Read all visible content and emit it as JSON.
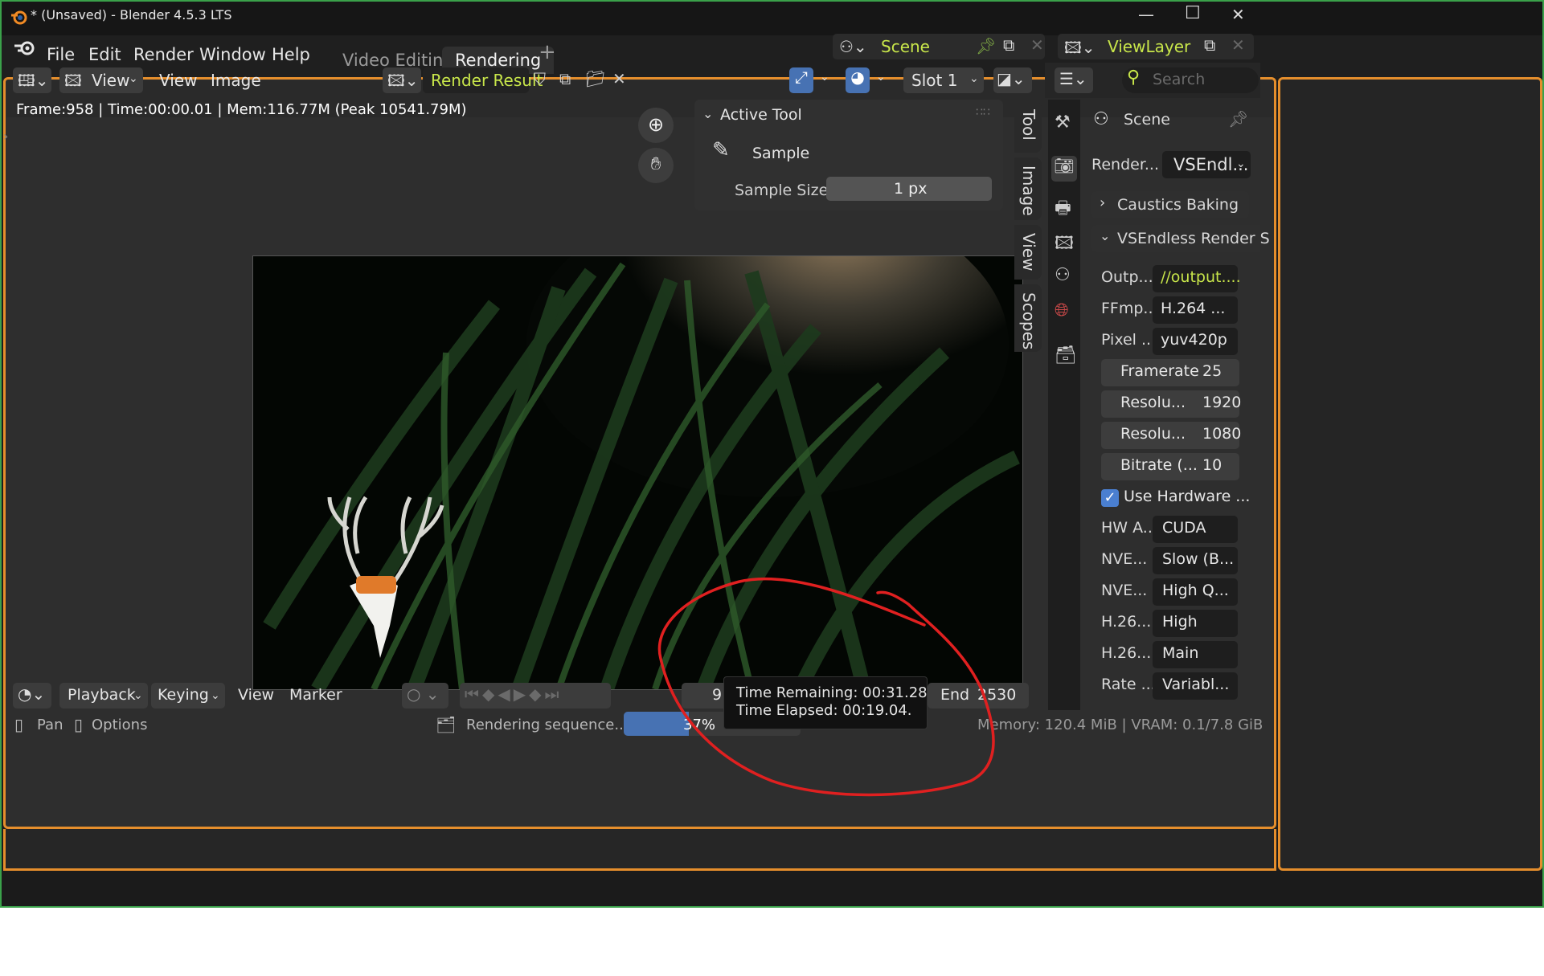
{
  "window": {
    "title": "* (Unsaved) - Blender 4.5.3 LTS",
    "minimize": "—",
    "maximize": "☐",
    "close": "✕"
  },
  "menu": [
    "File",
    "Edit",
    "Render",
    "Window",
    "Help"
  ],
  "workspaces": {
    "tabs": [
      "Video Editing",
      "Rendering"
    ],
    "active": "Rendering",
    "add": "+"
  },
  "scene": {
    "label": "Scene"
  },
  "viewlayer": {
    "label": "ViewLayer"
  },
  "image_editor": {
    "view_menu": "View",
    "menus": [
      "View",
      "Image"
    ],
    "image_name": "Render Result",
    "slot": "Slot 1",
    "info": "Frame:958 | Time:00:00.01 | Mem:116.77M (Peak 10541.79M)"
  },
  "active_tool": {
    "header": "Active Tool",
    "tool": "Sample",
    "sample_size_label": "Sample Size",
    "sample_size_value": "1 px"
  },
  "side_tabs": [
    "Tool",
    "Image",
    "View",
    "Scopes"
  ],
  "properties": {
    "search_placeholder": "Search",
    "scene": "Scene",
    "render_label": "Render...",
    "render_engine": "VSEndl...",
    "panels": [
      "Caustics Baking",
      "VSEndless Render S"
    ],
    "fields": [
      {
        "label": "Outp...",
        "value": "//output...."
      },
      {
        "label": "FFmp...",
        "value": "H.264 ..."
      },
      {
        "label": "Pixel ...",
        "value": "yuv420p"
      }
    ],
    "numbers": [
      {
        "label": "Framerate",
        "value": "25"
      },
      {
        "label": "Resolu...",
        "value": "1920"
      },
      {
        "label": "Resolu...",
        "value": "1080"
      },
      {
        "label": "Bitrate (...",
        "value": "10"
      }
    ],
    "checkbox": {
      "label": "Use Hardware ...",
      "checked": true
    },
    "dropdowns": [
      {
        "label": "HW A...",
        "value": "CUDA"
      },
      {
        "label": "NVE...",
        "value": "Slow (B..."
      },
      {
        "label": "NVE...",
        "value": "High Q..."
      },
      {
        "label": "H.26...",
        "value": "High"
      },
      {
        "label": "H.26...",
        "value": "Main"
      },
      {
        "label": "Rate ...",
        "value": "Variabl..."
      }
    ]
  },
  "timeline": {
    "menus": [
      "Playback",
      "Keying",
      "View",
      "Marker"
    ],
    "current_frame_partial": "9",
    "end_label": "End",
    "end_value": "2530"
  },
  "tooltip": {
    "remaining": "Time Remaining: 00:31.28",
    "elapsed": "Time Elapsed: 00:19.04."
  },
  "status": {
    "pan": "Pan",
    "options": "Options",
    "job": "Rendering sequence...",
    "progress_percent": 37,
    "progress_label": "37%",
    "memory": "Memory: 120.4 MiB | VRAM: 0.1/7.8 GiB"
  },
  "colors": {
    "accent_orange": "#e58e2c",
    "highlight_yellow": "#c8e64a",
    "window_border": "#3aa14a",
    "annotation_red": "#e02020",
    "progress_blue": "#4772b3",
    "checkbox_blue": "#4a7fd0"
  }
}
